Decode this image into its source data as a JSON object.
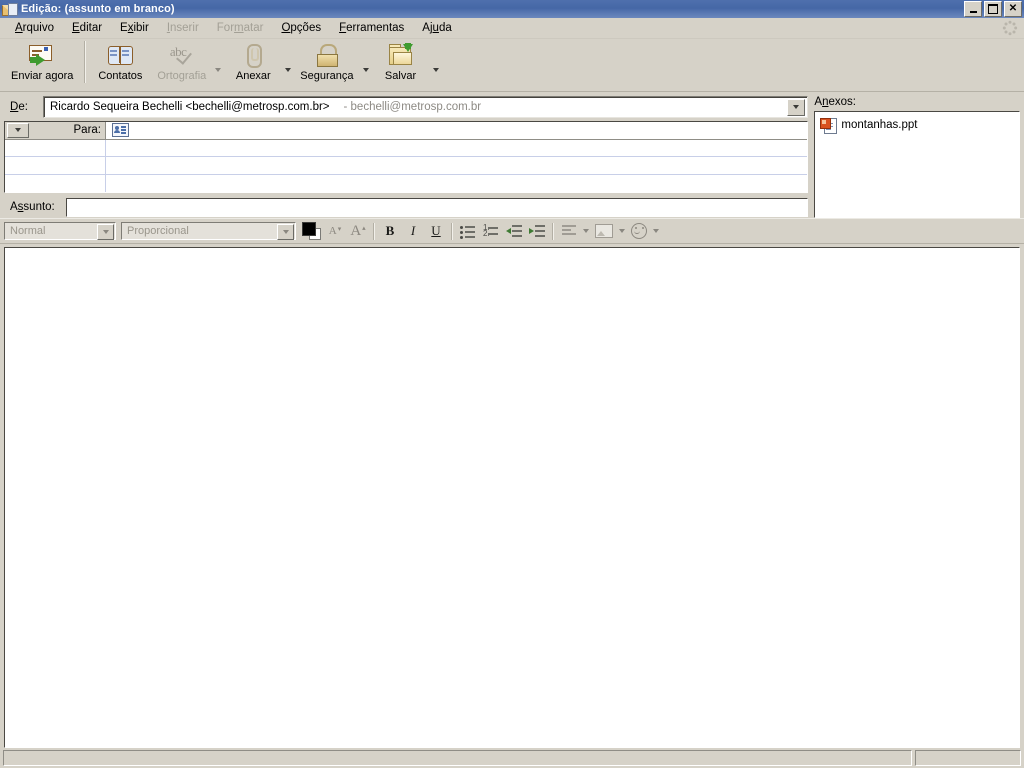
{
  "window": {
    "title": "Edição: (assunto em branco)",
    "icon": "mail-compose-icon",
    "minimize_label": "_",
    "maximize_label": "❐",
    "close_label": "✕"
  },
  "menubar": {
    "items": [
      {
        "label": "Arquivo",
        "accel": "A",
        "disabled": false
      },
      {
        "label": "Editar",
        "accel": "E",
        "disabled": false
      },
      {
        "label": "Exibir",
        "accel": "x",
        "disabled": false
      },
      {
        "label": "Inserir",
        "accel": "I",
        "disabled": true
      },
      {
        "label": "Formatar",
        "accel": "m",
        "disabled": true
      },
      {
        "label": "Opções",
        "accel": "O",
        "disabled": false
      },
      {
        "label": "Ferramentas",
        "accel": "F",
        "disabled": false
      },
      {
        "label": "Ajuda",
        "accel": "u",
        "disabled": false
      }
    ]
  },
  "toolbar": {
    "items": [
      {
        "label": "Enviar agora",
        "icon": "send-mail-icon",
        "disabled": false,
        "dropdown": false
      },
      {
        "label": "Contatos",
        "icon": "address-book-icon",
        "disabled": false,
        "dropdown": false
      },
      {
        "label": "Ortografia",
        "icon": "spellcheck-icon",
        "disabled": true,
        "dropdown": true
      },
      {
        "label": "Anexar",
        "icon": "paperclip-icon",
        "disabled": false,
        "dropdown": true
      },
      {
        "label": "Segurança",
        "icon": "lock-icon",
        "disabled": false,
        "dropdown": true
      },
      {
        "label": "Salvar",
        "icon": "save-folder-icon",
        "disabled": false,
        "dropdown": true
      }
    ]
  },
  "fields": {
    "from_label": "De:",
    "from_value": "Ricardo Sequeira Bechelli <bechelli@metrosp.com.br>",
    "from_account": "- bechelli@metrosp.com.br",
    "to_label": "Para:",
    "recipient_rows": [
      "",
      "",
      ""
    ],
    "subject_label": "Assunto:",
    "subject_value": "",
    "subject_placeholder": ""
  },
  "attachments": {
    "label": "Anexos:",
    "items": [
      {
        "name": "montanhas.ppt",
        "icon": "powerpoint-file-icon"
      }
    ]
  },
  "formatbar": {
    "style_value": "Normal",
    "font_value": "Proporcional",
    "color_label": "text-color",
    "buttons": [
      {
        "name": "decrease-font-size",
        "label": "A"
      },
      {
        "name": "increase-font-size",
        "label": "A"
      },
      {
        "name": "bold",
        "label": "B"
      },
      {
        "name": "italic",
        "label": "I"
      },
      {
        "name": "underline",
        "label": "U"
      },
      {
        "name": "bullet-list",
        "label": ""
      },
      {
        "name": "numbered-list",
        "label": "1.\n2."
      },
      {
        "name": "decrease-indent",
        "label": ""
      },
      {
        "name": "increase-indent",
        "label": ""
      },
      {
        "name": "align",
        "label": ""
      },
      {
        "name": "insert-image",
        "label": ""
      },
      {
        "name": "insert-smiley",
        "label": ""
      }
    ]
  },
  "body": {
    "content": ""
  },
  "statusbar": {
    "main_text": "",
    "right_text": ""
  },
  "colors": {
    "titlebar_start": "#4f70ad",
    "titlebar_end": "#6b88bd",
    "window_face": "#d6d2c8",
    "field_white": "#ffffff",
    "disabled_text": "#a3a096",
    "grid_line": "#c8cfe8"
  }
}
